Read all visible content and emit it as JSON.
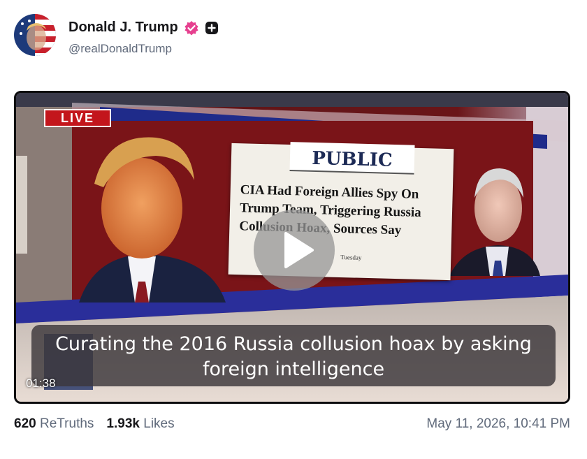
{
  "post": {
    "author": {
      "display_name": "Donald J. Trump",
      "handle": "@realDonaldTrump",
      "avatar_icon": "flag-portrait-avatar",
      "verified_icon": "verified-badge-icon",
      "verified_color": "#e91e8c",
      "extra_badge_icon": "plus-badge-icon"
    },
    "video": {
      "live_label": "LIVE",
      "document_tab": "PUBLIC",
      "document_headline": "CIA Had Foreign Allies Spy On Trump Team, Triggering Russia Collusion Hoax, Sources Say",
      "document_date": "Tuesday",
      "caption_line1": "Curating the 2016 Russia collusion hoax by asking",
      "caption_line2": "foreign intelligence",
      "duration": "01:38",
      "play_icon": "play-icon"
    },
    "stats": {
      "retruths_count": "620",
      "retruths_label": "ReTruths",
      "likes_count": "1.93k",
      "likes_label": "Likes"
    },
    "date": "May 11, 2026, 10:41 PM"
  }
}
